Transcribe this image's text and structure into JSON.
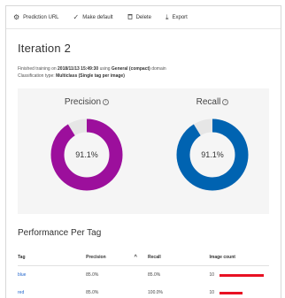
{
  "toolbar": {
    "items": [
      {
        "icon": "gear-icon",
        "glyph": "⚙",
        "label": "Prediction URL"
      },
      {
        "icon": "check-icon",
        "glyph": "✓",
        "label": "Make default"
      },
      {
        "icon": "trash-icon",
        "glyph": "🗑",
        "label": "Delete"
      },
      {
        "icon": "download-icon",
        "glyph": "⤓",
        "label": "Export"
      }
    ]
  },
  "iteration": {
    "title": "Iteration 2",
    "trained_prefix": "Finished training on",
    "trained_date": "2018/11/13 15:49:30",
    "trained_mid": "using",
    "domain_name": "General (compact)",
    "trained_suffix": "domain",
    "classification_prefix": "Classification type:",
    "classification_type": "Multiclass (Single tag per image)"
  },
  "metrics": {
    "precision": {
      "label": "Precision",
      "value": "91.1%",
      "fraction": 0.911,
      "color": "#9c0f9c"
    },
    "recall": {
      "label": "Recall",
      "value": "91.1%",
      "fraction": 0.911,
      "color": "#0063b1"
    }
  },
  "performance": {
    "title": "Performance Per Tag",
    "headers": {
      "tag": "Tag",
      "precision": "Precision",
      "recall": "Recall",
      "image_count": "Image count"
    },
    "rows": [
      {
        "tag": "blue",
        "precision": "85.0%",
        "recall": "85.0%",
        "count": "10",
        "bar_fraction": 0.95
      },
      {
        "tag": "red",
        "precision": "85.0%",
        "recall": "100.0%",
        "count": "10",
        "bar_fraction": 0.5
      }
    ]
  }
}
